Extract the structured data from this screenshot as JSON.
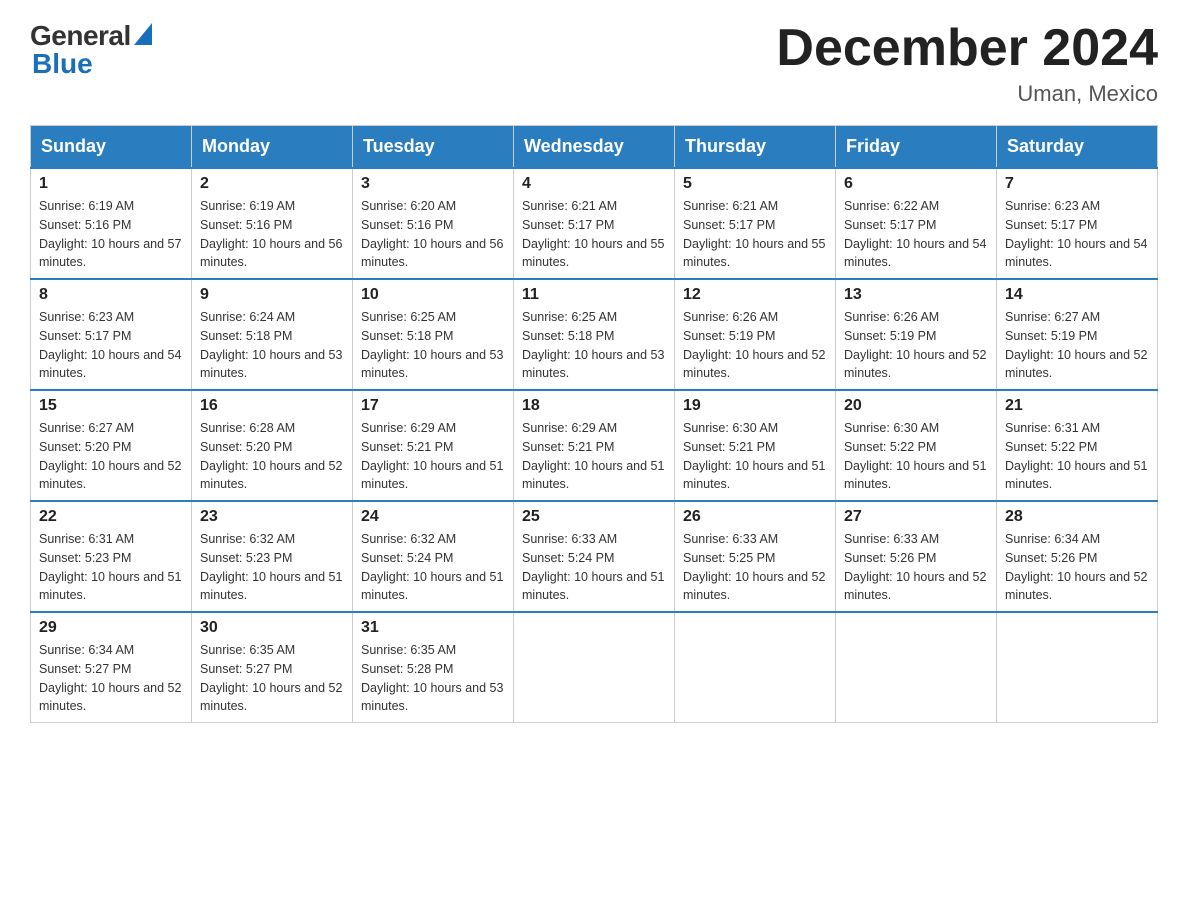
{
  "header": {
    "logo_general": "General",
    "logo_blue": "Blue",
    "title": "December 2024",
    "location": "Uman, Mexico"
  },
  "days_of_week": [
    "Sunday",
    "Monday",
    "Tuesday",
    "Wednesday",
    "Thursday",
    "Friday",
    "Saturday"
  ],
  "weeks": [
    [
      {
        "day": "1",
        "sunrise": "6:19 AM",
        "sunset": "5:16 PM",
        "daylight": "10 hours and 57 minutes."
      },
      {
        "day": "2",
        "sunrise": "6:19 AM",
        "sunset": "5:16 PM",
        "daylight": "10 hours and 56 minutes."
      },
      {
        "day": "3",
        "sunrise": "6:20 AM",
        "sunset": "5:16 PM",
        "daylight": "10 hours and 56 minutes."
      },
      {
        "day": "4",
        "sunrise": "6:21 AM",
        "sunset": "5:17 PM",
        "daylight": "10 hours and 55 minutes."
      },
      {
        "day": "5",
        "sunrise": "6:21 AM",
        "sunset": "5:17 PM",
        "daylight": "10 hours and 55 minutes."
      },
      {
        "day": "6",
        "sunrise": "6:22 AM",
        "sunset": "5:17 PM",
        "daylight": "10 hours and 54 minutes."
      },
      {
        "day": "7",
        "sunrise": "6:23 AM",
        "sunset": "5:17 PM",
        "daylight": "10 hours and 54 minutes."
      }
    ],
    [
      {
        "day": "8",
        "sunrise": "6:23 AM",
        "sunset": "5:17 PM",
        "daylight": "10 hours and 54 minutes."
      },
      {
        "day": "9",
        "sunrise": "6:24 AM",
        "sunset": "5:18 PM",
        "daylight": "10 hours and 53 minutes."
      },
      {
        "day": "10",
        "sunrise": "6:25 AM",
        "sunset": "5:18 PM",
        "daylight": "10 hours and 53 minutes."
      },
      {
        "day": "11",
        "sunrise": "6:25 AM",
        "sunset": "5:18 PM",
        "daylight": "10 hours and 53 minutes."
      },
      {
        "day": "12",
        "sunrise": "6:26 AM",
        "sunset": "5:19 PM",
        "daylight": "10 hours and 52 minutes."
      },
      {
        "day": "13",
        "sunrise": "6:26 AM",
        "sunset": "5:19 PM",
        "daylight": "10 hours and 52 minutes."
      },
      {
        "day": "14",
        "sunrise": "6:27 AM",
        "sunset": "5:19 PM",
        "daylight": "10 hours and 52 minutes."
      }
    ],
    [
      {
        "day": "15",
        "sunrise": "6:27 AM",
        "sunset": "5:20 PM",
        "daylight": "10 hours and 52 minutes."
      },
      {
        "day": "16",
        "sunrise": "6:28 AM",
        "sunset": "5:20 PM",
        "daylight": "10 hours and 52 minutes."
      },
      {
        "day": "17",
        "sunrise": "6:29 AM",
        "sunset": "5:21 PM",
        "daylight": "10 hours and 51 minutes."
      },
      {
        "day": "18",
        "sunrise": "6:29 AM",
        "sunset": "5:21 PM",
        "daylight": "10 hours and 51 minutes."
      },
      {
        "day": "19",
        "sunrise": "6:30 AM",
        "sunset": "5:21 PM",
        "daylight": "10 hours and 51 minutes."
      },
      {
        "day": "20",
        "sunrise": "6:30 AM",
        "sunset": "5:22 PM",
        "daylight": "10 hours and 51 minutes."
      },
      {
        "day": "21",
        "sunrise": "6:31 AM",
        "sunset": "5:22 PM",
        "daylight": "10 hours and 51 minutes."
      }
    ],
    [
      {
        "day": "22",
        "sunrise": "6:31 AM",
        "sunset": "5:23 PM",
        "daylight": "10 hours and 51 minutes."
      },
      {
        "day": "23",
        "sunrise": "6:32 AM",
        "sunset": "5:23 PM",
        "daylight": "10 hours and 51 minutes."
      },
      {
        "day": "24",
        "sunrise": "6:32 AM",
        "sunset": "5:24 PM",
        "daylight": "10 hours and 51 minutes."
      },
      {
        "day": "25",
        "sunrise": "6:33 AM",
        "sunset": "5:24 PM",
        "daylight": "10 hours and 51 minutes."
      },
      {
        "day": "26",
        "sunrise": "6:33 AM",
        "sunset": "5:25 PM",
        "daylight": "10 hours and 52 minutes."
      },
      {
        "day": "27",
        "sunrise": "6:33 AM",
        "sunset": "5:26 PM",
        "daylight": "10 hours and 52 minutes."
      },
      {
        "day": "28",
        "sunrise": "6:34 AM",
        "sunset": "5:26 PM",
        "daylight": "10 hours and 52 minutes."
      }
    ],
    [
      {
        "day": "29",
        "sunrise": "6:34 AM",
        "sunset": "5:27 PM",
        "daylight": "10 hours and 52 minutes."
      },
      {
        "day": "30",
        "sunrise": "6:35 AM",
        "sunset": "5:27 PM",
        "daylight": "10 hours and 52 minutes."
      },
      {
        "day": "31",
        "sunrise": "6:35 AM",
        "sunset": "5:28 PM",
        "daylight": "10 hours and 53 minutes."
      },
      null,
      null,
      null,
      null
    ]
  ]
}
